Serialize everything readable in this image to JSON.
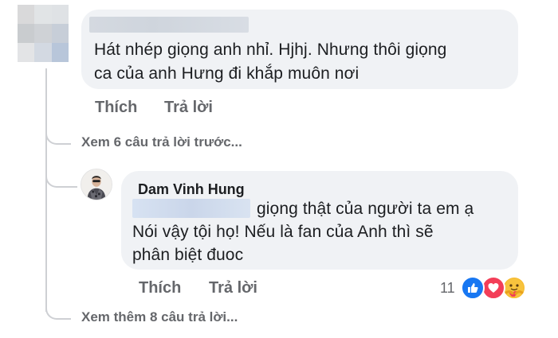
{
  "comment1": {
    "author_redacted": true,
    "text_line1": "Hát nhép giọng anh nhỉ. Hjhj. Nhưng thôi giọng",
    "text_line2": "ca của anh Hưng đi khắp muôn nơi",
    "like_label": "Thích",
    "reply_label": "Trả lời"
  },
  "view_previous": "Xem 6 câu trả lời trước...",
  "reply": {
    "author": "Dam Vinh Hung",
    "mention_redacted": true,
    "text_line1": "giọng thật của người ta em ạ",
    "text_line2": "Nói vậy tội họ! Nếu là fan của Anh thì sẽ",
    "text_line3": "phân biệt đuoc",
    "like_label": "Thích",
    "reply_label": "Trả lời",
    "reaction_count": "11",
    "reactions": [
      "like-icon",
      "love-icon",
      "care-icon"
    ]
  },
  "view_more": "Xem thêm 8 câu trả lời...",
  "colors": {
    "bubble_bg": "#f0f2f5",
    "meta_text": "#65676b",
    "like_blue": "#1877f2",
    "love_red": "#f33e58",
    "care_yellow": "#f7b928"
  }
}
